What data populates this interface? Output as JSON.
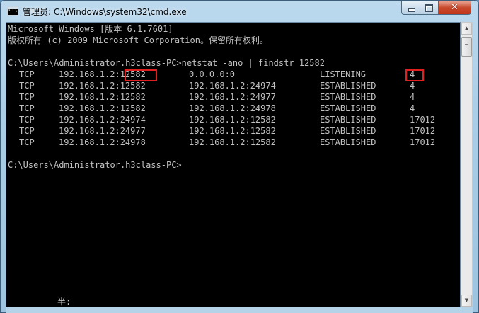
{
  "window": {
    "title": "管理员: C:\\Windows\\system32\\cmd.exe",
    "app_icon": "cmd-icon",
    "minimize_icon": "minimize-icon",
    "maximize_icon": "maximize-icon",
    "close_icon": "close-icon",
    "close_glyph": "✕"
  },
  "console": {
    "banner": [
      "Microsoft Windows [版本 6.1.7601]",
      "版权所有 (c) 2009 Microsoft Corporation。保留所有权利。"
    ],
    "command_line": "C:\\Users\\Administrator.h3class-PC>netstat -ano | findstr 12582",
    "table": [
      {
        "proto": "TCP",
        "local": "192.168.1.2:",
        "local_port": "12582",
        "foreign": "0.0.0.0:0",
        "state": "LISTENING",
        "pid": "4"
      },
      {
        "proto": "TCP",
        "local": "192.168.1.2:",
        "local_port": "12582",
        "foreign": "192.168.1.2:24974",
        "state": "ESTABLISHED",
        "pid": "4"
      },
      {
        "proto": "TCP",
        "local": "192.168.1.2:",
        "local_port": "12582",
        "foreign": "192.168.1.2:24977",
        "state": "ESTABLISHED",
        "pid": "4"
      },
      {
        "proto": "TCP",
        "local": "192.168.1.2:",
        "local_port": "12582",
        "foreign": "192.168.1.2:24978",
        "state": "ESTABLISHED",
        "pid": "4"
      },
      {
        "proto": "TCP",
        "local": "192.168.1.2:",
        "local_port": "24974",
        "foreign": "192.168.1.2:12582",
        "state": "ESTABLISHED",
        "pid": "17012"
      },
      {
        "proto": "TCP",
        "local": "192.168.1.2:",
        "local_port": "24977",
        "foreign": "192.168.1.2:12582",
        "state": "ESTABLISHED",
        "pid": "17012"
      },
      {
        "proto": "TCP",
        "local": "192.168.1.2:",
        "local_port": "24978",
        "foreign": "192.168.1.2:12582",
        "state": "ESTABLISHED",
        "pid": "17012"
      }
    ],
    "prompt": "C:\\Users\\Administrator.h3class-PC>",
    "ime_status": "半:",
    "text_color": "#c0c0c0",
    "background_color": "#000000",
    "highlight_color": "#e02020"
  },
  "scrollbar": {
    "up_icon": "arrow-up-icon",
    "down_icon": "arrow-down-icon",
    "up_glyph": "▲",
    "down_glyph": "▼"
  }
}
